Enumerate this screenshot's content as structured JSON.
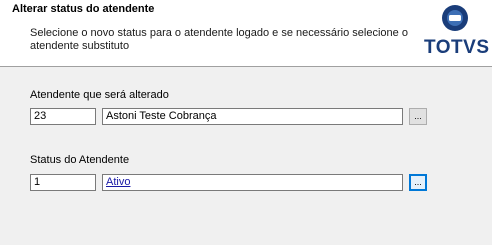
{
  "header": {
    "title": "Alterar status do atendente",
    "description": "Selecione o novo status para o atendente logado e se necessário selecione o atendente substituto",
    "logo_text": "TOTVS"
  },
  "attendant": {
    "label": "Atendente que será alterado",
    "code": "23",
    "name": "Astoni Teste Cobrança",
    "lookup_label": "..."
  },
  "status": {
    "label": "Status do Atendente",
    "code": "1",
    "name": "Ativo",
    "lookup_label": "..."
  }
}
